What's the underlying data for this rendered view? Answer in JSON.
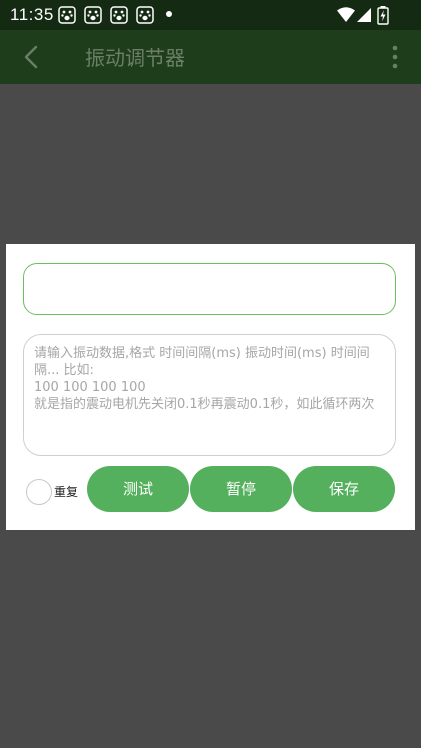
{
  "status_bar": {
    "time": "11:35",
    "app_icons": [
      "paw-icon",
      "paw-icon",
      "paw-icon",
      "paw-icon"
    ],
    "right_icons": [
      "wifi-icon",
      "signal-icon",
      "battery-charging-icon"
    ]
  },
  "app_bar": {
    "title": "振动调节器"
  },
  "dialog": {
    "name_input": {
      "value": "",
      "placeholder": ""
    },
    "data_input": {
      "value": "",
      "placeholder": "请输入振动数据,格式 时间间隔(ms) 振动时间(ms) 时间间隔... 比如:\n100 100 100 100\n就是指的震动电机先关闭0.1秒再震动0.1秒，如此循环两次"
    },
    "repeat_label": "重复",
    "buttons": {
      "test": "测试",
      "pause": "暂停",
      "save": "保存"
    }
  },
  "colors": {
    "status_bar": "#152a12",
    "app_bar": "#1e3d1a",
    "overlay": "#4a4a4a",
    "accent": "#54b05c",
    "input_border": "#6cbf5f"
  }
}
